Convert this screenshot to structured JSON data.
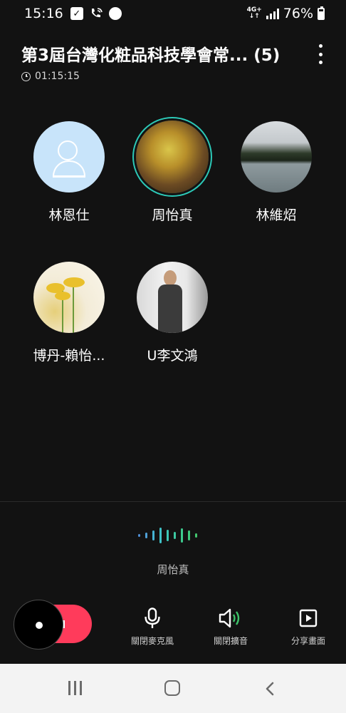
{
  "status_bar": {
    "time": "15:16",
    "network": "4G+",
    "battery": "76%",
    "icons": [
      "checkbox-icon",
      "wifi-call-icon",
      "app-icon",
      "signal-icon",
      "battery-icon"
    ]
  },
  "header": {
    "title": "第3屆台灣化粧品科技學會常... (5)",
    "duration": "01:15:15"
  },
  "participants": [
    {
      "name": "林恩仕",
      "avatar": "default-person-icon"
    },
    {
      "name": "周怡真",
      "avatar": "photo",
      "speaking": true
    },
    {
      "name": "林維炤",
      "avatar": "photo"
    },
    {
      "name": "博丹-賴怡...",
      "avatar": "photo"
    },
    {
      "name": "U李文鴻",
      "avatar": "photo"
    }
  ],
  "active_speaker": "周怡真",
  "controls": {
    "mic_label": "關閉麥克風",
    "speaker_label": "關閉擴音",
    "share_label": "分享畫面"
  },
  "colors": {
    "background": "#121212",
    "end_call": "#ff3b5b",
    "speaking_ring": "#2cc9b7",
    "speaker_wave": "#3ec36a"
  }
}
